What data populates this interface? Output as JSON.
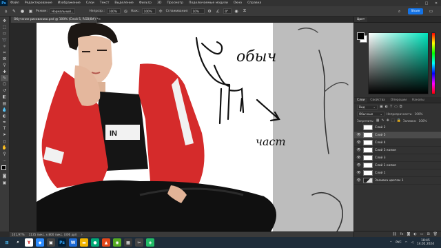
{
  "app": {
    "logo": "Ps"
  },
  "menu": [
    "Файл",
    "Редактирование",
    "Изображение",
    "Слои",
    "Текст",
    "Выделение",
    "Фильтр",
    "3D",
    "Просмотр",
    "Подключаемые модули",
    "Окно",
    "Справка"
  ],
  "options": {
    "mode_label": "Режим:",
    "mode_value": "Нормальный",
    "opacity_label": "Непрозр.:",
    "opacity_value": "100%",
    "flow_label": "Наж.:",
    "flow_value": "100%",
    "smoothing_label": "Сглаживание:",
    "smoothing_value": "10%",
    "angle_value": "0°",
    "share_label": "Share"
  },
  "document_tab": {
    "title": "Обучение рисованию.psd @ 100% (Слой 5, RGB/8#) *",
    "close": "×"
  },
  "statusbar": {
    "zoom": "101,97%",
    "info": "1135 пикс. x 800 пикс. (300 ppi)"
  },
  "color_panel": {
    "tabs": [
      "Цвет"
    ],
    "accent": "#00e5bd"
  },
  "layers_panel": {
    "tabs": [
      "Слои",
      "Свойства",
      "Операции",
      "Каналы"
    ],
    "filter_value": "Вид",
    "blend_value": "Обычные",
    "opacity_label": "Непрозрачность:",
    "opacity_value": "100%",
    "lock_label": "Закрепить:",
    "fill_label": "Заливка:",
    "fill_value": "100%",
    "layers": [
      {
        "name": "Слой 2",
        "visible": false,
        "selected": false
      },
      {
        "name": "Слой 5",
        "visible": true,
        "selected": true
      },
      {
        "name": "Слой 4",
        "visible": true,
        "selected": false
      },
      {
        "name": "Слой 3 копия",
        "visible": true,
        "selected": false
      },
      {
        "name": "Слой 3",
        "visible": true,
        "selected": false
      },
      {
        "name": "Слой 1 копия",
        "visible": true,
        "selected": false
      },
      {
        "name": "Слой 1",
        "visible": true,
        "selected": false
      },
      {
        "name": "Заливка цветом 1",
        "visible": true,
        "selected": false
      }
    ]
  },
  "canvas": {
    "sketch_word_1": "обыч",
    "sketch_word_2": "част"
  },
  "taskbar": {
    "lang": "РУС",
    "time": "18:45",
    "date": "14.05.2024"
  }
}
